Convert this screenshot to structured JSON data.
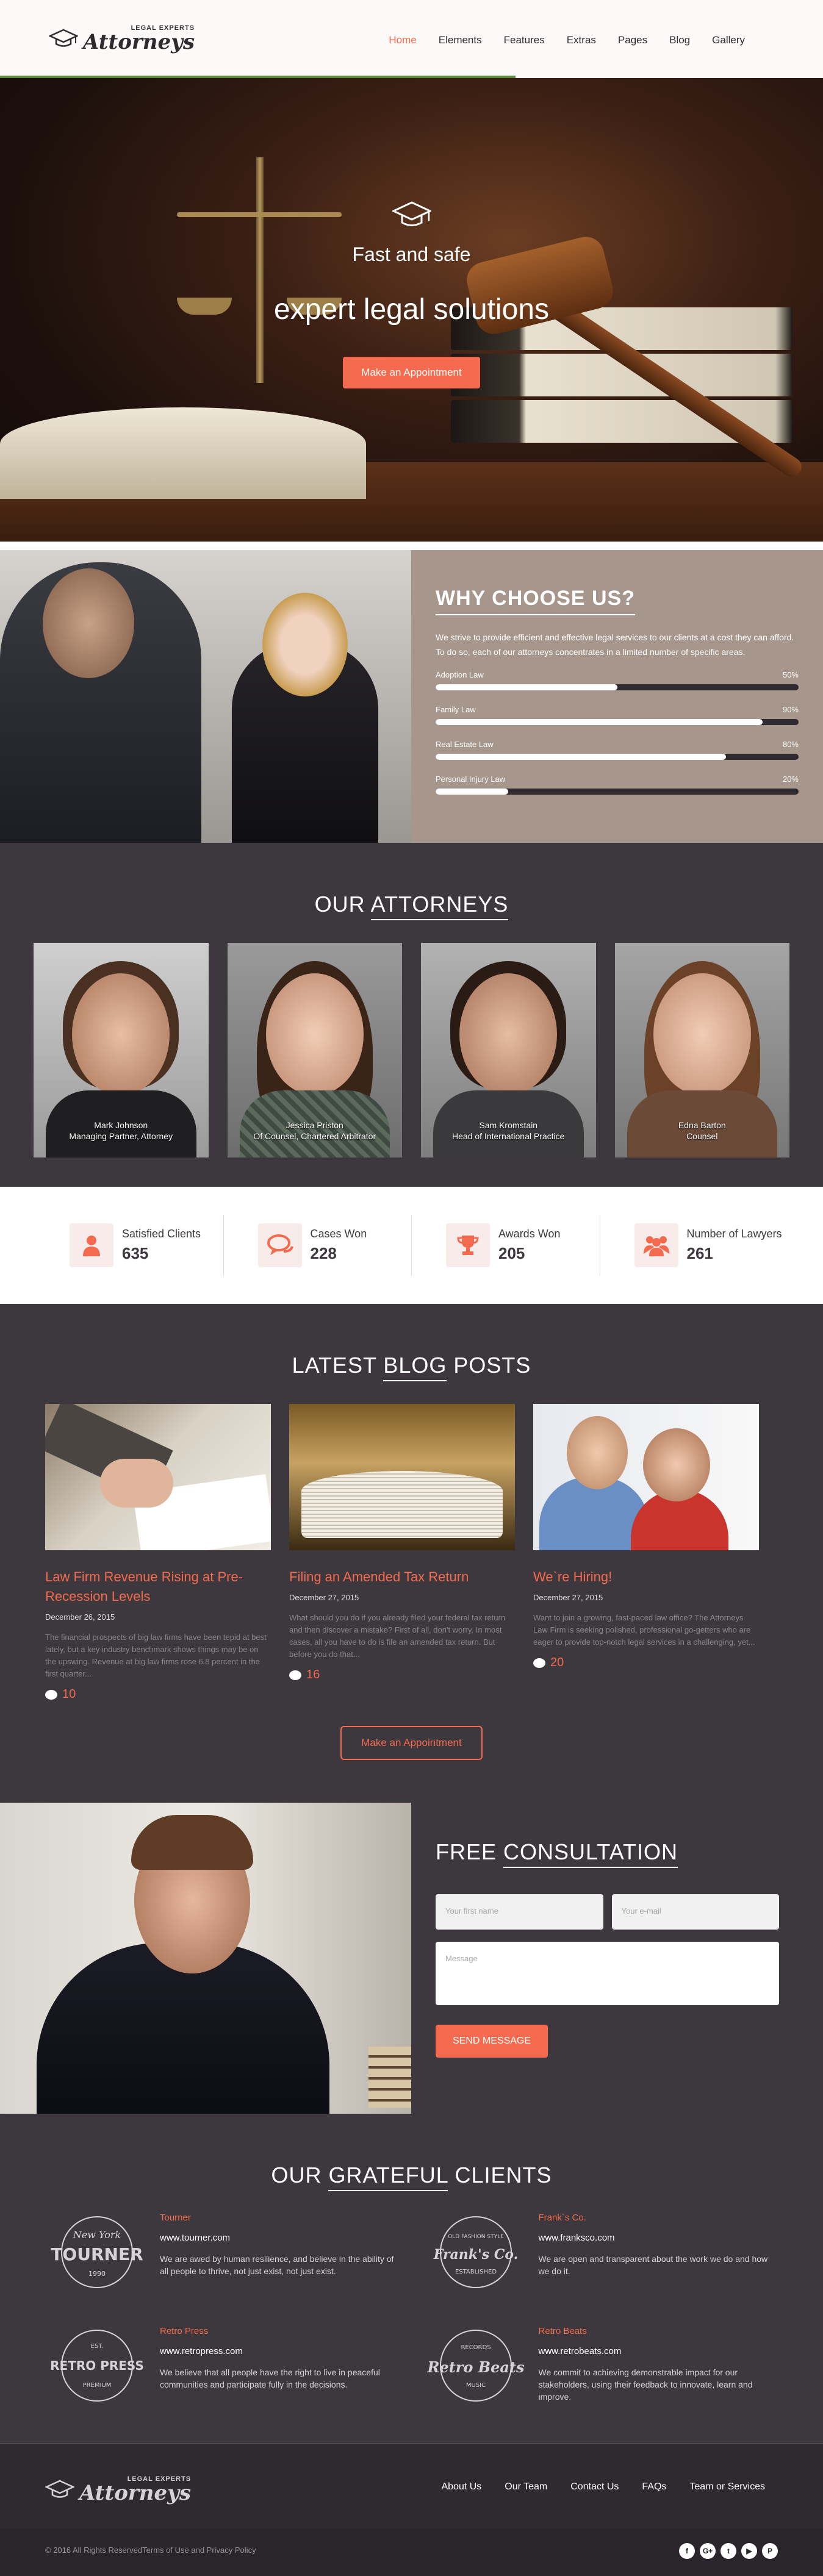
{
  "header": {
    "logo_small": "LEGAL EXPERTS",
    "logo_big": "Attorneys",
    "nav": [
      "Home",
      "Elements",
      "Features",
      "Extras",
      "Pages",
      "Blog",
      "Gallery"
    ]
  },
  "hero": {
    "subtitle": "Fast and safe",
    "title": "expert legal solutions",
    "button": "Make an Appointment"
  },
  "why": {
    "title": "WHY CHOOSE US?",
    "text": "We strive to provide efficient and effective legal services to our clients at a cost they can afford. To do so, each of our attorneys concentrates in a limited number of specific areas.",
    "skills": [
      {
        "label": "Adoption Law",
        "value": "50%",
        "fraction": 0.5
      },
      {
        "label": "Family Law",
        "value": "90%",
        "fraction": 0.9
      },
      {
        "label": "Real Estate Law",
        "value": "80%",
        "fraction": 0.8
      },
      {
        "label": "Personal Injury Law",
        "value": "20%",
        "fraction": 0.2
      }
    ]
  },
  "attorneys": {
    "title_a": "OUR",
    "title_b": "ATTORNEYS",
    "people": [
      {
        "name": "Mark Johnson",
        "role": "Managing Partner, Attorney"
      },
      {
        "name": "Jessica Priston",
        "role": "Of Counsel, Chartered Arbitrator"
      },
      {
        "name": "Sam Kromstain",
        "role": "Head of International Practice"
      },
      {
        "name": "Edna Barton",
        "role": "Counsel"
      }
    ]
  },
  "stats": [
    {
      "label": "Satisfied Clients",
      "value": "635",
      "icon": "person-icon"
    },
    {
      "label": "Cases Won",
      "value": "228",
      "icon": "chat-icon"
    },
    {
      "label": "Awards Won",
      "value": "205",
      "icon": "trophy-icon"
    },
    {
      "label": "Number of Lawyers",
      "value": "261",
      "icon": "group-icon"
    }
  ],
  "blog": {
    "title_a": "LATEST",
    "title_b": "BLOG",
    "title_c": "POSTS",
    "posts": [
      {
        "title": "Law Firm Revenue Rising at Pre-Recession Levels",
        "date": "December 26, 2015",
        "excerpt": "The financial prospects of big law firms have been tepid at best lately, but a key industry benchmark shows things may be on the upswing. Revenue at big law firms rose 6.8 percent in the first quarter...",
        "comments": "10"
      },
      {
        "title": "Filing an Amended Tax Return",
        "date": "December 27, 2015",
        "excerpt": "What should you do if you already filed your federal tax return and then discover a mistake? First of all, don't worry. In most cases, all you have to do is file an amended tax return. But before you do that...",
        "comments": "16"
      },
      {
        "title": "We`re Hiring!",
        "date": "December 27, 2015",
        "excerpt": "Want to join a growing, fast-paced law office? The Attorneys Law Firm is seeking polished, professional go-getters who are eager to provide top-notch legal services in a challenging, yet...",
        "comments": "20"
      }
    ],
    "button": "Make an Appointment"
  },
  "consult": {
    "title_a": "FREE",
    "title_b": "CONSULTATION",
    "name_placeholder": "Your first name",
    "email_placeholder": "Your e-mail",
    "message_placeholder": "Message",
    "button": "SEND MESSAGE"
  },
  "clients": {
    "title_a": "OUR",
    "title_b": "GRATEFUL",
    "title_c": "CLIENTS",
    "items": [
      {
        "name": "Tourner",
        "url": "www.tourner.com",
        "desc": "We are awed by human resilience, and believe in the ability of all people to thrive, not just exist, not just exist.",
        "seal_top": "New York",
        "seal_main": "TOURNER",
        "seal_sub": "1990"
      },
      {
        "name": "Frank`s Co.",
        "url": "www.franksco.com",
        "desc": "We are open and transparent about the work we do and how we do it.",
        "seal_top": "OLD FASHION STYLE",
        "seal_main": "Frank's Co.",
        "seal_sub": "ESTABLISHED"
      },
      {
        "name": "Retro Press",
        "url": "www.retropress.com",
        "desc": "We believe that all people have the right to live in peaceful communities and participate fully in the decisions.",
        "seal_top": "EST.",
        "seal_main": "RETRO PRESS",
        "seal_sub": "PREMIUM"
      },
      {
        "name": "Retro Beats",
        "url": "www.retrobeats.com",
        "desc": "We commit to achieving demonstrable impact for our stakeholders, using their feedback to innovate, learn and improve.",
        "seal_top": "RECORDS",
        "seal_main": "Retro Beats",
        "seal_sub": "MUSIC"
      }
    ]
  },
  "footer": {
    "nav": [
      "About Us",
      "Our Team",
      "Contact Us",
      "FAQs",
      "Team or Services"
    ],
    "copyright": "© 2016 All Rights Reserved",
    "terms": "Terms of Use and Privacy Policy",
    "socials": [
      "f",
      "G+",
      "t",
      "▶",
      "P"
    ]
  },
  "colors": {
    "accent": "#f46a4e",
    "dark": "#3d383d",
    "taupe": "#a6968b"
  }
}
